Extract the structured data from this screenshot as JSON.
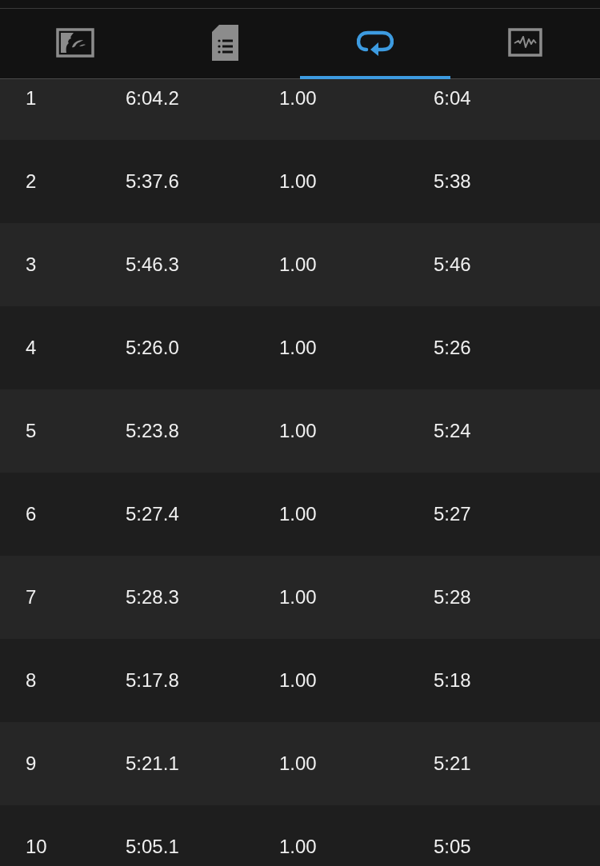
{
  "tabs": [
    {
      "selected": false
    },
    {
      "selected": false
    },
    {
      "selected": true
    },
    {
      "selected": false
    }
  ],
  "table": {
    "rows": [
      [
        "1",
        "6:04.2",
        "1.00",
        "6:04"
      ],
      [
        "2",
        "5:37.6",
        "1.00",
        "5:38"
      ],
      [
        "3",
        "5:46.3",
        "1.00",
        "5:46"
      ],
      [
        "4",
        "5:26.0",
        "1.00",
        "5:26"
      ],
      [
        "5",
        "5:23.8",
        "1.00",
        "5:24"
      ],
      [
        "6",
        "5:27.4",
        "1.00",
        "5:27"
      ],
      [
        "7",
        "5:28.3",
        "1.00",
        "5:28"
      ],
      [
        "8",
        "5:17.8",
        "1.00",
        "5:18"
      ],
      [
        "9",
        "5:21.1",
        "1.00",
        "5:21"
      ],
      [
        "10",
        "5:05.1",
        "1.00",
        "5:05"
      ]
    ]
  }
}
